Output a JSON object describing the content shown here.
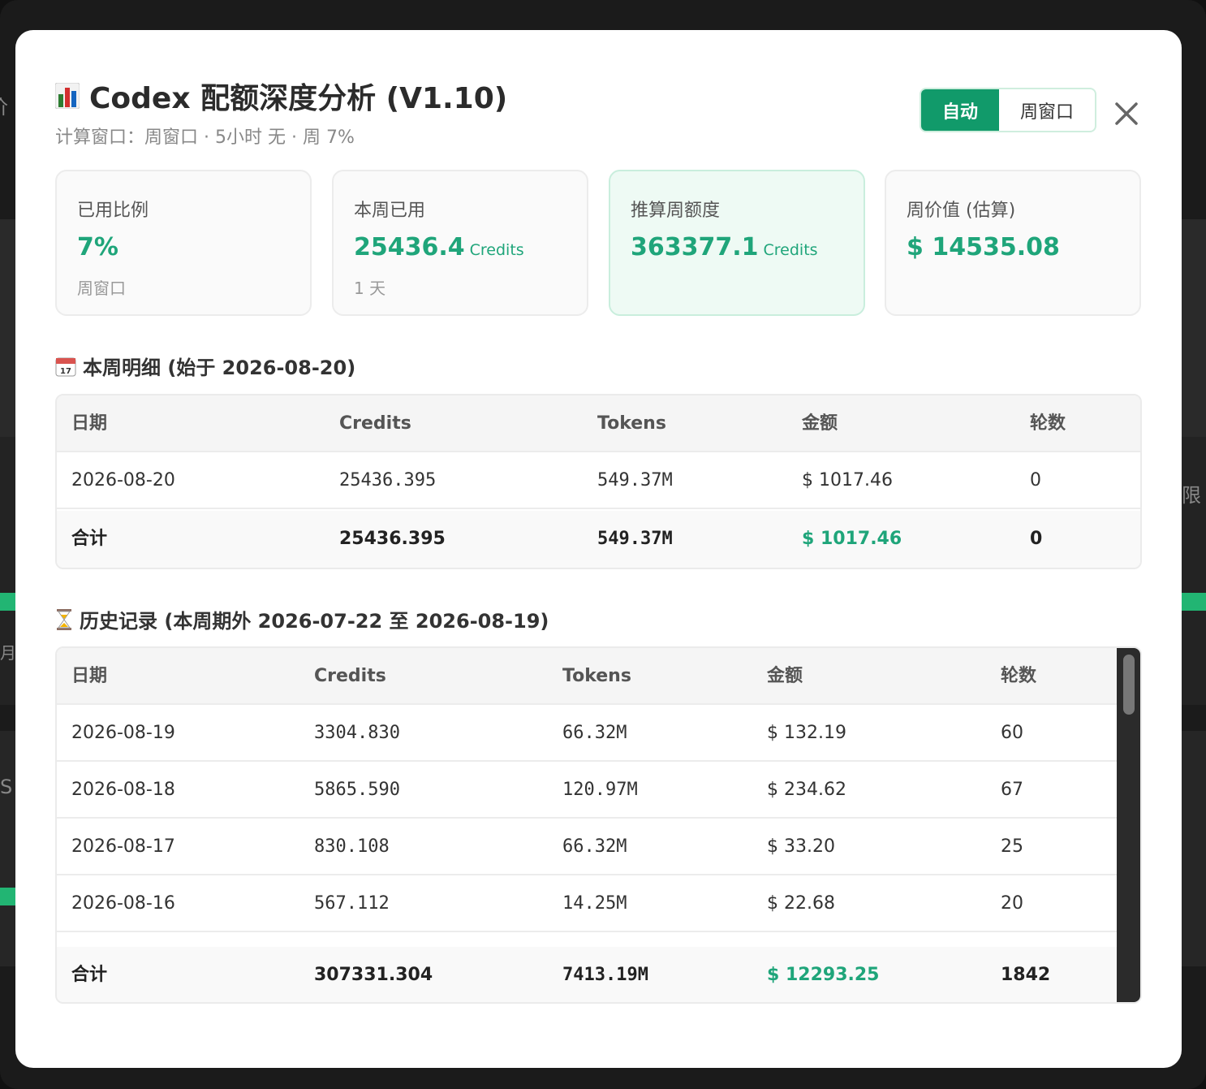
{
  "header": {
    "title": "Codex 配额深度分析 (V1.10)",
    "subtitle": "计算窗口：周窗口 · 5小时 无 · 周 7%",
    "segments": [
      "自动",
      "周窗口"
    ]
  },
  "cards": [
    {
      "label": "已用比例",
      "value": "7%",
      "unit": "",
      "sub": "周窗口"
    },
    {
      "label": "本周已用",
      "value": "25436.4",
      "unit": "Credits",
      "sub": "1 天"
    },
    {
      "label": "推算周额度",
      "value": "363377.1",
      "unit": "Credits",
      "sub": ""
    },
    {
      "label": "周价值 (估算)",
      "value": "$ 14535.08",
      "unit": "",
      "sub": ""
    }
  ],
  "week": {
    "title": "本周明细 (始于 2026-08-20)",
    "headers": [
      "日期",
      "Credits",
      "Tokens",
      "金额",
      "轮数"
    ],
    "rows": [
      [
        "2026-08-20",
        "25436.395",
        "549.37M",
        "$ 1017.46",
        "0"
      ]
    ],
    "total": [
      "合计",
      "25436.395",
      "549.37M",
      "$ 1017.46",
      "0"
    ]
  },
  "history": {
    "title": "历史记录 (本周期外 2026-07-22 至 2026-08-19)",
    "headers": [
      "日期",
      "Credits",
      "Tokens",
      "金额",
      "轮数"
    ],
    "rows": [
      [
        "2026-08-19",
        "3304.830",
        "66.32M",
        "$ 132.19",
        "60"
      ],
      [
        "2026-08-18",
        "5865.590",
        "120.97M",
        "$ 234.62",
        "67"
      ],
      [
        "2026-08-17",
        "830.108",
        "66.32M",
        "$ 33.20",
        "25"
      ],
      [
        "2026-08-16",
        "567.112",
        "14.25M",
        "$ 22.68",
        "20"
      ]
    ],
    "total": [
      "合计",
      "307331.304",
      "7413.19M",
      "$ 12293.25",
      "1842"
    ]
  },
  "background": {
    "fragments": [
      "价",
      "限",
      "月",
      "S"
    ]
  },
  "colors": {
    "accent": "#119a6a",
    "value_green": "#1fa57a"
  }
}
